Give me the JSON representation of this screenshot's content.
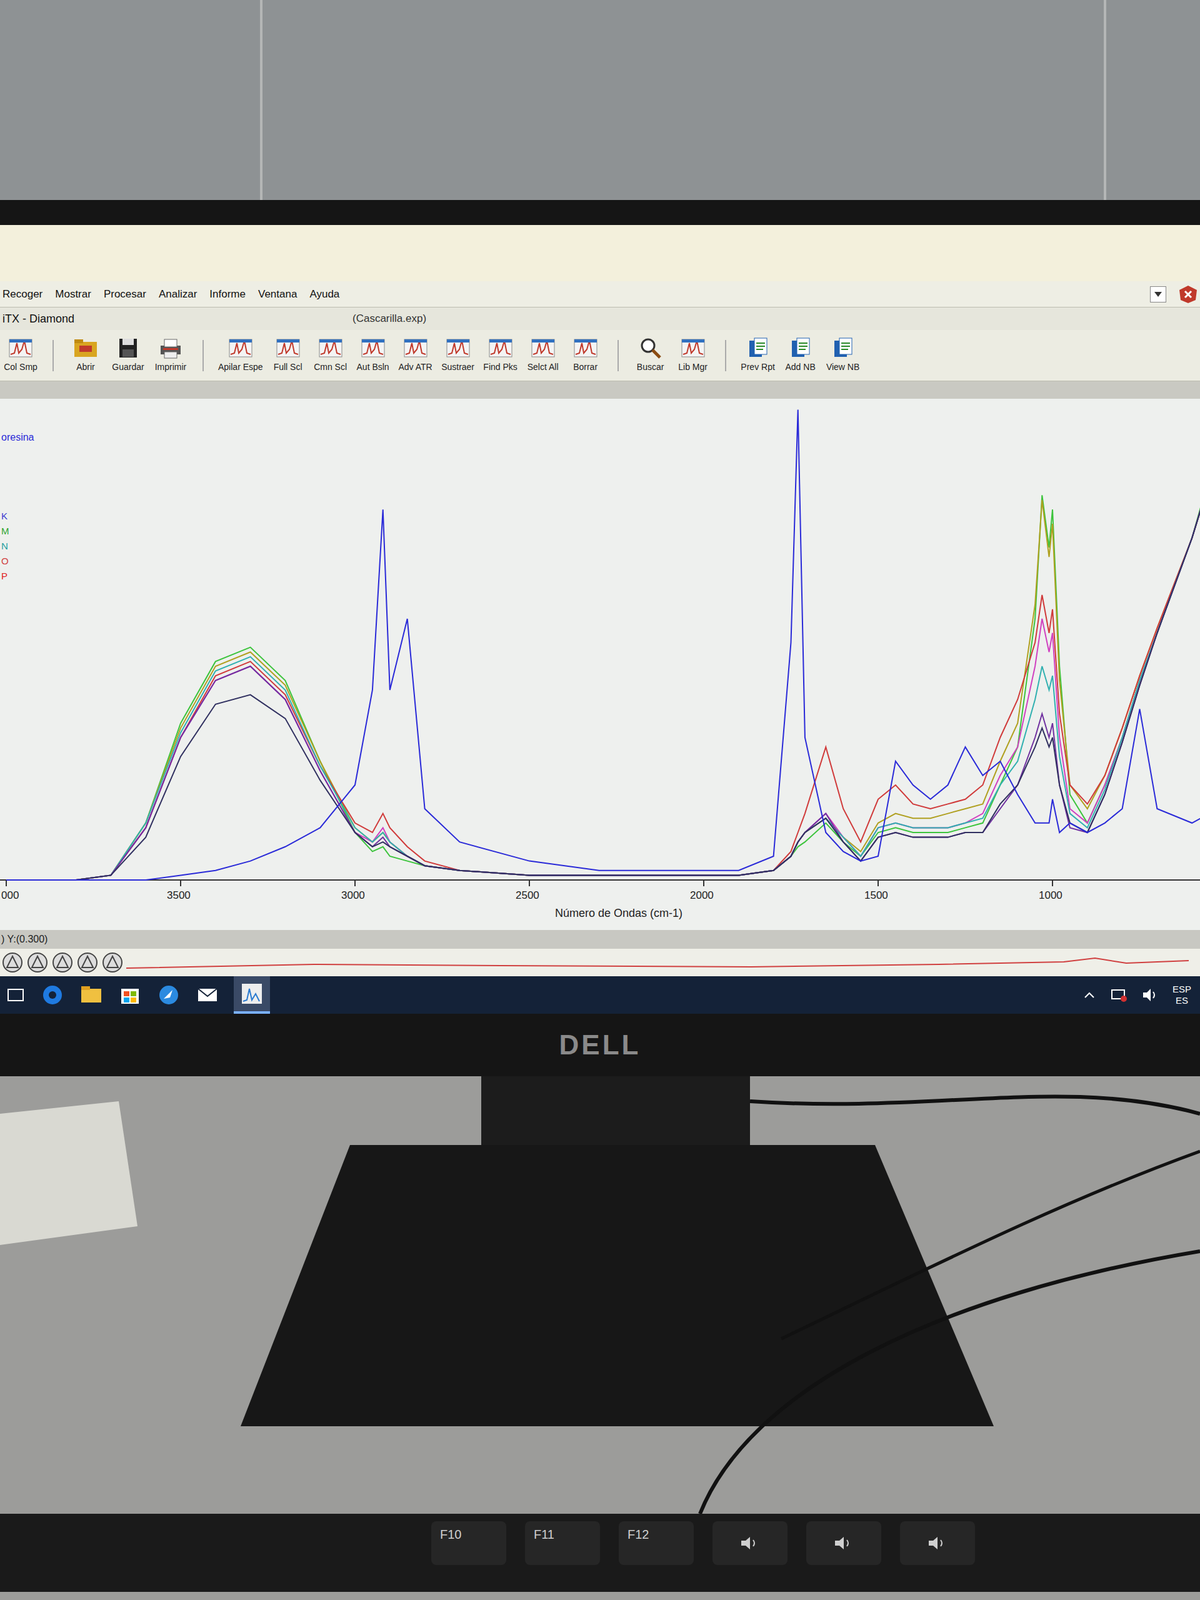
{
  "menu": [
    "Recoger",
    "Mostrar",
    "Procesar",
    "Analizar",
    "Informe",
    "Ventana",
    "Ayuda"
  ],
  "app_title": "iTX - Diamond",
  "file_name": "(Cascarilla.exp)",
  "toolbar": [
    [
      "Col Smp"
    ],
    [
      "Abrir",
      "Guardar",
      "Imprimir"
    ],
    [
      "Apilar Espe",
      "Full Scl",
      "Cmn Scl",
      "Aut Bsln",
      "Adv ATR",
      "Sustraer",
      "Find Pks",
      "Selct All",
      "Borrar"
    ],
    [
      "Buscar",
      "Lib Mgr"
    ],
    [
      "Prev Rpt",
      "Add NB",
      "View NB"
    ]
  ],
  "chart": {
    "legend_title": "oresina",
    "legend": [
      {
        "label": "K",
        "color": "#3b3bd0"
      },
      {
        "label": "M",
        "color": "#2ea52e"
      },
      {
        "label": "N",
        "color": "#22a0a0"
      },
      {
        "label": "O",
        "color": "#d04040"
      },
      {
        "label": "P",
        "color": "#e02020"
      }
    ],
    "x_axis": {
      "label": "Número de Ondas (cm-1)",
      "ticks": [
        "000",
        "3500",
        "3000",
        "2500",
        "2000",
        "1500",
        "1000"
      ]
    },
    "wavenumbers": [
      4000,
      3800,
      3700,
      3600,
      3500,
      3400,
      3300,
      3200,
      3100,
      3000,
      2950,
      2920,
      2900,
      2850,
      2800,
      2700,
      2500,
      2300,
      2100,
      1900,
      1800,
      1750,
      1730,
      1710,
      1650,
      1600,
      1550,
      1500,
      1450,
      1400,
      1350,
      1300,
      1250,
      1200,
      1150,
      1100,
      1050,
      1030,
      1010,
      1000,
      980,
      950,
      900,
      850,
      800,
      750,
      700,
      600,
      550
    ],
    "series": [
      {
        "color": "#3cc43c",
        "values": [
          0,
          0,
          0.01,
          0.12,
          0.33,
          0.46,
          0.49,
          0.42,
          0.25,
          0.1,
          0.06,
          0.07,
          0.05,
          0.04,
          0.03,
          0.02,
          0.01,
          0.01,
          0.01,
          0.01,
          0.02,
          0.05,
          0.07,
          0.08,
          0.12,
          0.08,
          0.05,
          0.1,
          0.11,
          0.1,
          0.1,
          0.1,
          0.11,
          0.12,
          0.2,
          0.28,
          0.55,
          0.81,
          0.7,
          0.78,
          0.45,
          0.18,
          0.12,
          0.2,
          0.3,
          0.42,
          0.52,
          0.72,
          0.85
        ]
      },
      {
        "color": "#b0a020",
        "values": [
          0,
          0,
          0.01,
          0.12,
          0.32,
          0.45,
          0.48,
          0.41,
          0.25,
          0.11,
          0.08,
          0.1,
          0.08,
          0.05,
          0.03,
          0.02,
          0.01,
          0.01,
          0.01,
          0.01,
          0.02,
          0.05,
          0.08,
          0.1,
          0.13,
          0.09,
          0.06,
          0.12,
          0.14,
          0.13,
          0.13,
          0.14,
          0.15,
          0.16,
          0.25,
          0.33,
          0.58,
          0.8,
          0.68,
          0.75,
          0.42,
          0.2,
          0.15,
          0.22,
          0.32,
          0.43,
          0.53,
          0.72,
          0.84
        ]
      },
      {
        "color": "#d03a3a",
        "values": [
          0,
          0,
          0.01,
          0.11,
          0.3,
          0.43,
          0.46,
          0.39,
          0.24,
          0.12,
          0.1,
          0.14,
          0.11,
          0.07,
          0.04,
          0.02,
          0.01,
          0.01,
          0.01,
          0.01,
          0.02,
          0.06,
          0.1,
          0.14,
          0.28,
          0.15,
          0.08,
          0.17,
          0.2,
          0.16,
          0.15,
          0.16,
          0.17,
          0.2,
          0.3,
          0.38,
          0.5,
          0.6,
          0.52,
          0.57,
          0.35,
          0.2,
          0.16,
          0.22,
          0.32,
          0.43,
          0.53,
          0.72,
          0.84
        ]
      },
      {
        "color": "#d040c0",
        "values": [
          0,
          0,
          0.01,
          0.11,
          0.3,
          0.42,
          0.45,
          0.38,
          0.23,
          0.1,
          0.08,
          0.11,
          0.08,
          0.05,
          0.03,
          0.02,
          0.01,
          0.01,
          0.01,
          0.01,
          0.02,
          0.05,
          0.08,
          0.1,
          0.14,
          0.09,
          0.05,
          0.11,
          0.12,
          0.11,
          0.11,
          0.11,
          0.12,
          0.14,
          0.22,
          0.28,
          0.45,
          0.55,
          0.48,
          0.52,
          0.3,
          0.15,
          0.12,
          0.2,
          0.3,
          0.42,
          0.52,
          0.72,
          0.84
        ]
      },
      {
        "color": "#30b0b0",
        "values": [
          0,
          0,
          0.01,
          0.12,
          0.31,
          0.44,
          0.47,
          0.4,
          0.24,
          0.11,
          0.08,
          0.1,
          0.08,
          0.05,
          0.03,
          0.02,
          0.01,
          0.01,
          0.01,
          0.01,
          0.02,
          0.05,
          0.08,
          0.1,
          0.13,
          0.09,
          0.05,
          0.11,
          0.12,
          0.11,
          0.11,
          0.11,
          0.12,
          0.13,
          0.2,
          0.25,
          0.38,
          0.45,
          0.4,
          0.43,
          0.26,
          0.14,
          0.11,
          0.19,
          0.3,
          0.42,
          0.52,
          0.72,
          0.84
        ]
      },
      {
        "color": "#7030a0",
        "values": [
          0,
          0,
          0.01,
          0.11,
          0.3,
          0.42,
          0.45,
          0.38,
          0.23,
          0.1,
          0.07,
          0.09,
          0.07,
          0.05,
          0.03,
          0.02,
          0.01,
          0.01,
          0.01,
          0.01,
          0.02,
          0.05,
          0.08,
          0.1,
          0.14,
          0.08,
          0.04,
          0.09,
          0.1,
          0.09,
          0.09,
          0.09,
          0.1,
          0.1,
          0.15,
          0.2,
          0.3,
          0.35,
          0.3,
          0.33,
          0.2,
          0.11,
          0.1,
          0.18,
          0.29,
          0.41,
          0.52,
          0.72,
          0.84
        ]
      },
      {
        "color": "#303060",
        "values": [
          0,
          0,
          0.01,
          0.09,
          0.26,
          0.37,
          0.39,
          0.34,
          0.21,
          0.1,
          0.07,
          0.08,
          0.07,
          0.05,
          0.03,
          0.02,
          0.01,
          0.01,
          0.01,
          0.01,
          0.02,
          0.05,
          0.08,
          0.1,
          0.13,
          0.08,
          0.04,
          0.09,
          0.1,
          0.09,
          0.09,
          0.09,
          0.1,
          0.1,
          0.16,
          0.2,
          0.28,
          0.32,
          0.28,
          0.3,
          0.2,
          0.12,
          0.1,
          0.18,
          0.29,
          0.41,
          0.52,
          0.72,
          0.84
        ]
      },
      {
        "color": "#2a2ad8",
        "values": [
          0,
          0,
          0,
          0,
          0.01,
          0.02,
          0.04,
          0.07,
          0.11,
          0.2,
          0.4,
          0.78,
          0.4,
          0.55,
          0.15,
          0.08,
          0.04,
          0.02,
          0.02,
          0.02,
          0.05,
          0.5,
          0.99,
          0.3,
          0.1,
          0.06,
          0.04,
          0.05,
          0.25,
          0.2,
          0.17,
          0.2,
          0.28,
          0.22,
          0.25,
          0.18,
          0.12,
          0.12,
          0.12,
          0.17,
          0.1,
          0.12,
          0.1,
          0.12,
          0.15,
          0.36,
          0.15,
          0.12,
          0.14
        ]
      }
    ]
  },
  "status": ") Y:(0.300)",
  "tray": [
    "ESP",
    "ES"
  ],
  "monitor_logo": "DELL",
  "keyboard_keys": [
    "F10",
    "F11",
    "F12"
  ]
}
